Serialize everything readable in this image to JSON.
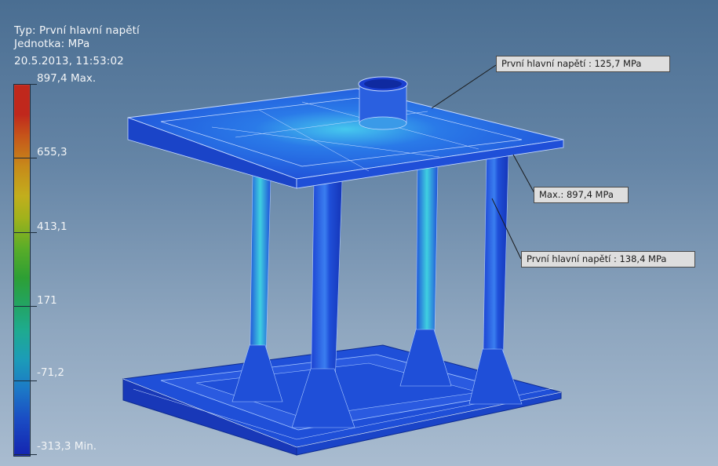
{
  "legend": {
    "type_line": "Typ: První hlavní napětí",
    "unit_line": "Jednotka: MPa",
    "date_line": "20.5.2013, 11:53:02",
    "scale_values": [
      "897,4 Max.",
      "655,3",
      "413,1",
      "171",
      "-71,2",
      "-313,3 Min."
    ]
  },
  "callouts": {
    "top": "První hlavní napětí : 125,7 MPa",
    "max": "Max.: 897,4 MPa",
    "right": "První hlavní napětí : 138,4 MPa"
  },
  "colors": {
    "structure_blue": "#1f4fd8",
    "highlight_cyan": "#3fd0e0",
    "scale_max": "#c0281c",
    "scale_min": "#1424b0"
  }
}
